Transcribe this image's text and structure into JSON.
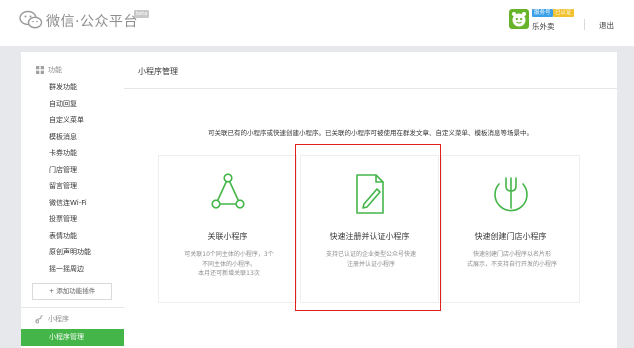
{
  "header": {
    "brand": "微信·公众平台",
    "beta": "beta",
    "badge_a": "服务号",
    "badge_b": "已认证",
    "username": "乐外卖",
    "logout": "退出"
  },
  "sidebar": {
    "section_label": "功能",
    "items": [
      {
        "label": "群发功能"
      },
      {
        "label": "自动回复"
      },
      {
        "label": "自定义菜单"
      },
      {
        "label": "模板消息"
      },
      {
        "label": "卡券功能"
      },
      {
        "label": "门店管理"
      },
      {
        "label": "留言管理"
      },
      {
        "label": "微信连Wi-Fi"
      },
      {
        "label": "投票管理"
      },
      {
        "label": "表情功能"
      },
      {
        "label": "原创声明功能"
      },
      {
        "label": "摇一摇周边"
      }
    ],
    "add_plugin": "+ 添加功能插件",
    "mini_section": "小程序",
    "mini_active": "小程序管理"
  },
  "main": {
    "title": "小程序管理",
    "intro": "可关联已有的小程序或快速创建小程序。已关联的小程序可被使用在群发文章、自定义菜单、模板消息等场景中。",
    "cards": [
      {
        "title": "关联小程序",
        "desc": [
          "可关联10个同主体的小程序，3个",
          "不同主体的小程序。",
          "本月还可新增关联13次"
        ],
        "icon": "share-network-icon"
      },
      {
        "title": "快速注册并认证小程序",
        "desc": [
          "支持已认证的企业类型公众号快速",
          "注册并认证小程序"
        ],
        "icon": "document-edit-icon"
      },
      {
        "title": "快速创建门店小程序",
        "desc": [
          "快速创建门店小程序以名片形",
          "式展示，不支持自行开发的小程序"
        ],
        "icon": "fork-plate-icon"
      }
    ]
  },
  "colors": {
    "accent": "#44b549",
    "highlight": "#e02020",
    "background": "#e7e8eb"
  }
}
